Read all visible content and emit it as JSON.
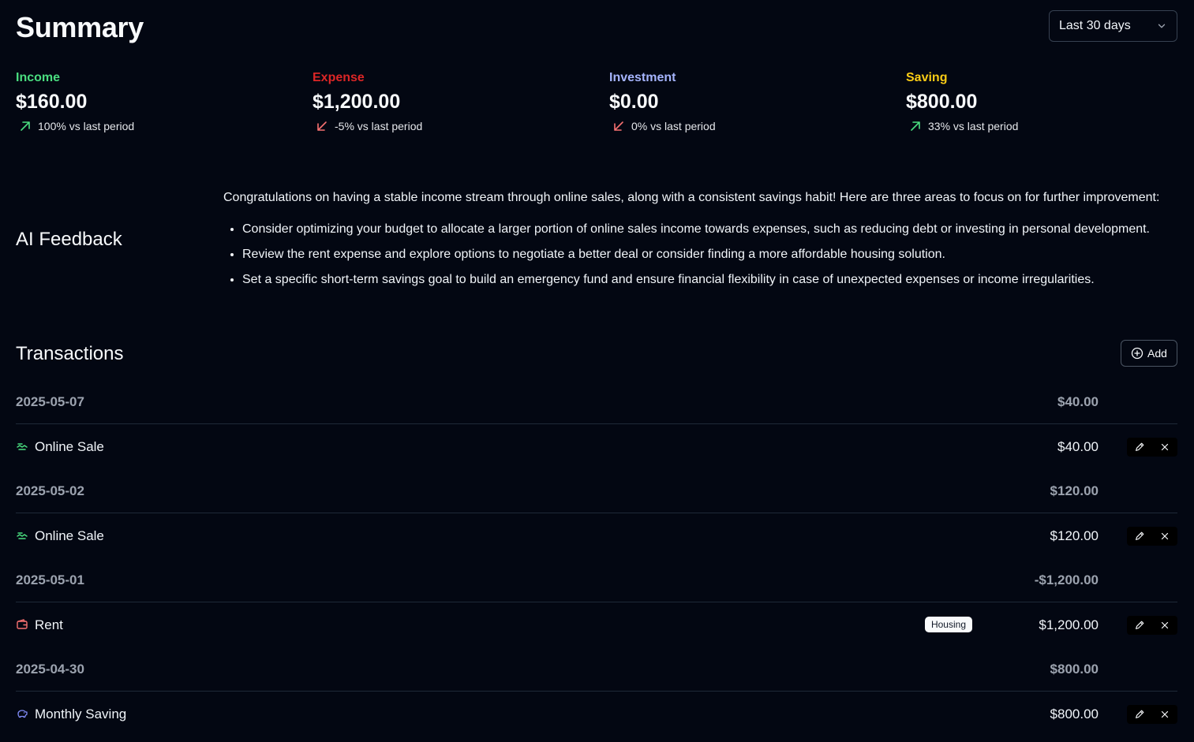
{
  "header": {
    "title": "Summary",
    "period": "Last 30 days"
  },
  "stats": [
    {
      "label": "Income",
      "value": "$160.00",
      "change": "100% vs last period",
      "direction": "up",
      "color": "#4ade80"
    },
    {
      "label": "Expense",
      "value": "$1,200.00",
      "change": "-5% vs last period",
      "direction": "down",
      "color": "#dc2626"
    },
    {
      "label": "Investment",
      "value": "$0.00",
      "change": "0% vs last period",
      "direction": "down",
      "color": "#a5b4fc"
    },
    {
      "label": "Saving",
      "value": "$800.00",
      "change": "33% vs last period",
      "direction": "up",
      "color": "#facc15"
    }
  ],
  "ai_feedback": {
    "title": "AI Feedback",
    "intro": "Congratulations on having a stable income stream through online sales, along with a consistent savings habit! Here are three areas to focus on for further improvement:",
    "points": [
      "Consider optimizing your budget to allocate a larger portion of online sales income towards expenses, such as reducing debt or investing in personal development.",
      "Review the rent expense and explore options to negotiate a better deal or consider finding a more affordable housing solution.",
      "Set a specific short-term savings goal to build an emergency fund and ensure financial flexibility in case of unexpected expenses or income irregularities."
    ]
  },
  "transactions": {
    "title": "Transactions",
    "add_label": "Add",
    "groups": [
      {
        "date": "2025-05-07",
        "total": "$40.00",
        "items": [
          {
            "name": "Online Sale",
            "amount": "$40.00",
            "icon": "income-icon",
            "category": ""
          }
        ]
      },
      {
        "date": "2025-05-02",
        "total": "$120.00",
        "items": [
          {
            "name": "Online Sale",
            "amount": "$120.00",
            "icon": "income-icon",
            "category": ""
          }
        ]
      },
      {
        "date": "2025-05-01",
        "total": "-$1,200.00",
        "items": [
          {
            "name": "Rent",
            "amount": "$1,200.00",
            "icon": "wallet-icon",
            "category": "Housing"
          }
        ]
      },
      {
        "date": "2025-04-30",
        "total": "$800.00",
        "items": [
          {
            "name": "Monthly Saving",
            "amount": "$800.00",
            "icon": "piggy-bank-icon",
            "category": ""
          }
        ]
      }
    ]
  },
  "colors": {
    "background": "#030712",
    "income": "#4ade80",
    "expense": "#f87171",
    "investment": "#818cf8",
    "saving": "#facc15",
    "muted": "#9ca3af"
  }
}
